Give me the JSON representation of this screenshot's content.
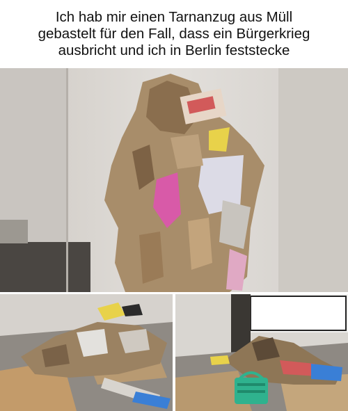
{
  "caption": {
    "lines": [
      "Ich hab mir einen Tarnanzug aus Müll",
      "gebastelt für den Fall, dass ein Bürgerkrieg",
      "ausbricht und ich in Berlin feststecke"
    ]
  },
  "photos": [
    {
      "subject": "trash-ghillie-suit-standing"
    },
    {
      "subject": "trash-suit-lying-on-cardboard"
    },
    {
      "subject": "trash-suit-lying-with-basket"
    }
  ],
  "colors": {
    "wall": "#d9d6d2",
    "cardboard": "#b89a72",
    "floor": "#8f8a84",
    "pink": "#d85aa8",
    "yellow": "#e8d24a",
    "teal-basket": "#2fb28e"
  }
}
